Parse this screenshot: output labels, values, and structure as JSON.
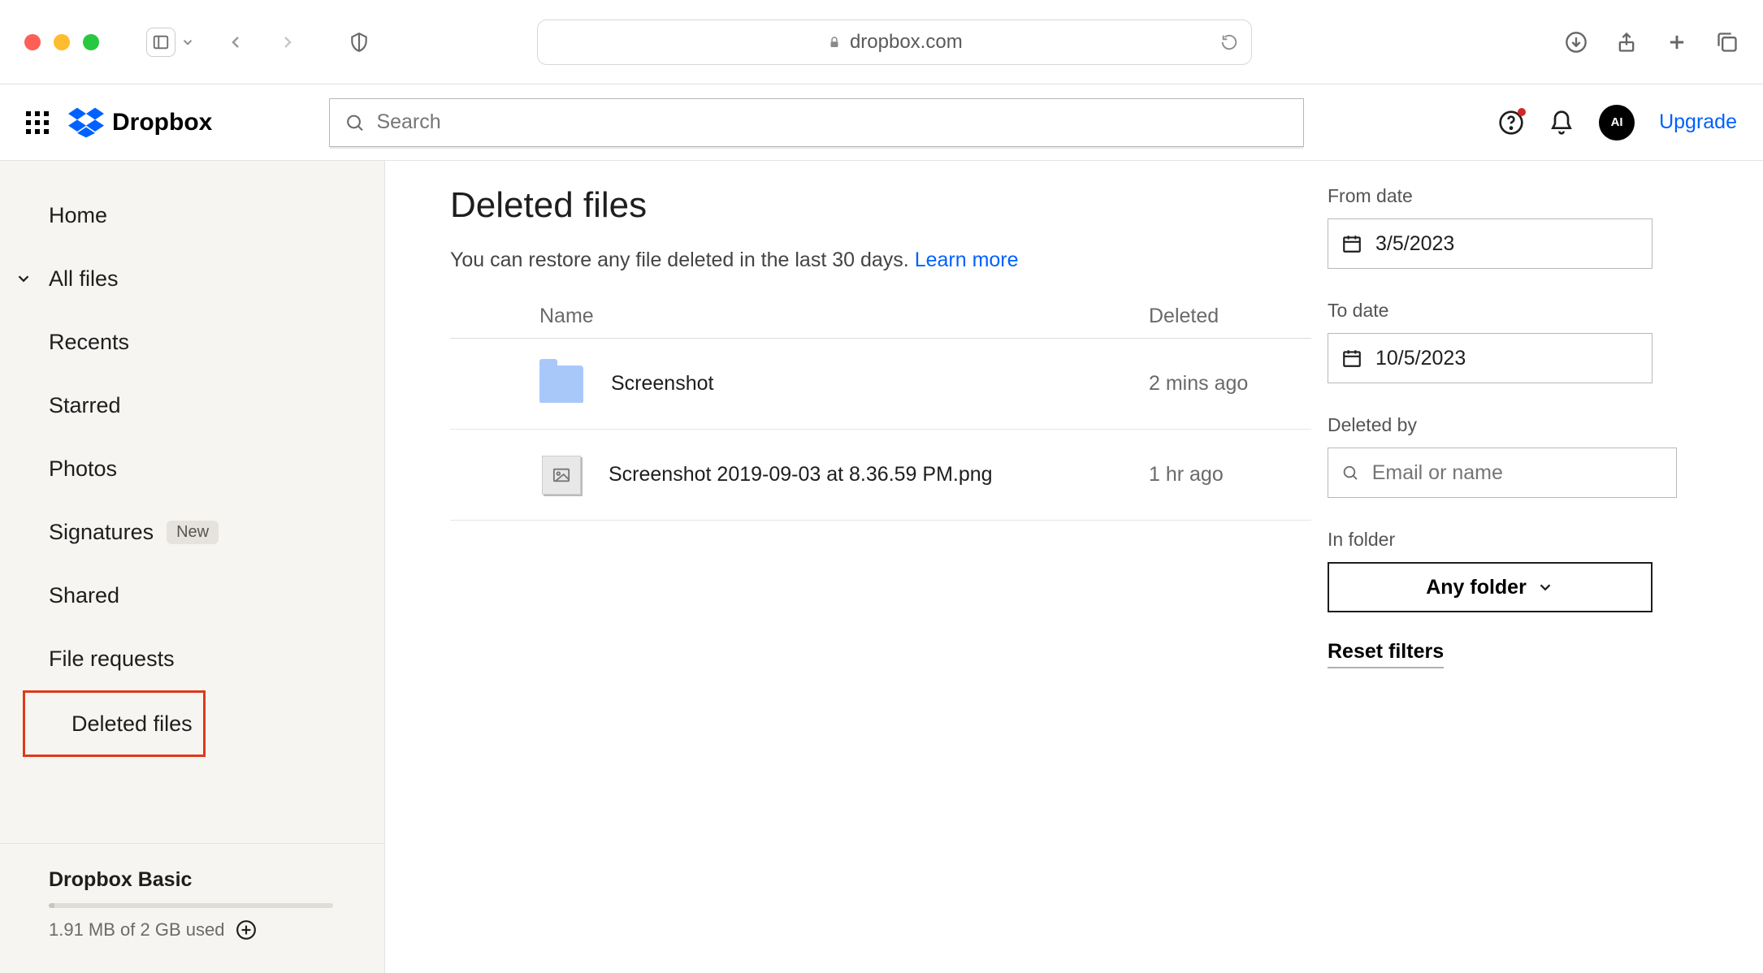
{
  "browser": {
    "domain": "dropbox.com"
  },
  "header": {
    "brand": "Dropbox",
    "search_placeholder": "Search",
    "avatar_initials": "AI",
    "upgrade_label": "Upgrade"
  },
  "sidebar": {
    "items": [
      {
        "label": "Home"
      },
      {
        "label": "All files",
        "has_chevron": true
      },
      {
        "label": "Recents"
      },
      {
        "label": "Starred"
      },
      {
        "label": "Photos"
      },
      {
        "label": "Signatures",
        "badge": "New"
      },
      {
        "label": "Shared"
      },
      {
        "label": "File requests"
      },
      {
        "label": "Deleted files",
        "highlighted": true
      }
    ],
    "plan": "Dropbox Basic",
    "usage": "1.91 MB of 2 GB used"
  },
  "page": {
    "title": "Deleted files",
    "subtitle": "You can restore any file deleted in the last 30 days.",
    "learn_more": "Learn more",
    "columns": {
      "name": "Name",
      "deleted": "Deleted"
    },
    "rows": [
      {
        "type": "folder",
        "name": "Screenshot",
        "deleted": "2 mins ago"
      },
      {
        "type": "image",
        "name": "Screenshot 2019-09-03 at 8.36.59 PM.png",
        "deleted": "1 hr ago"
      }
    ]
  },
  "filters": {
    "from_date_label": "From date",
    "from_date_value": "3/5/2023",
    "to_date_label": "To date",
    "to_date_value": "10/5/2023",
    "deleted_by_label": "Deleted by",
    "deleted_by_placeholder": "Email or name",
    "in_folder_label": "In folder",
    "in_folder_value": "Any folder",
    "reset_label": "Reset filters"
  }
}
